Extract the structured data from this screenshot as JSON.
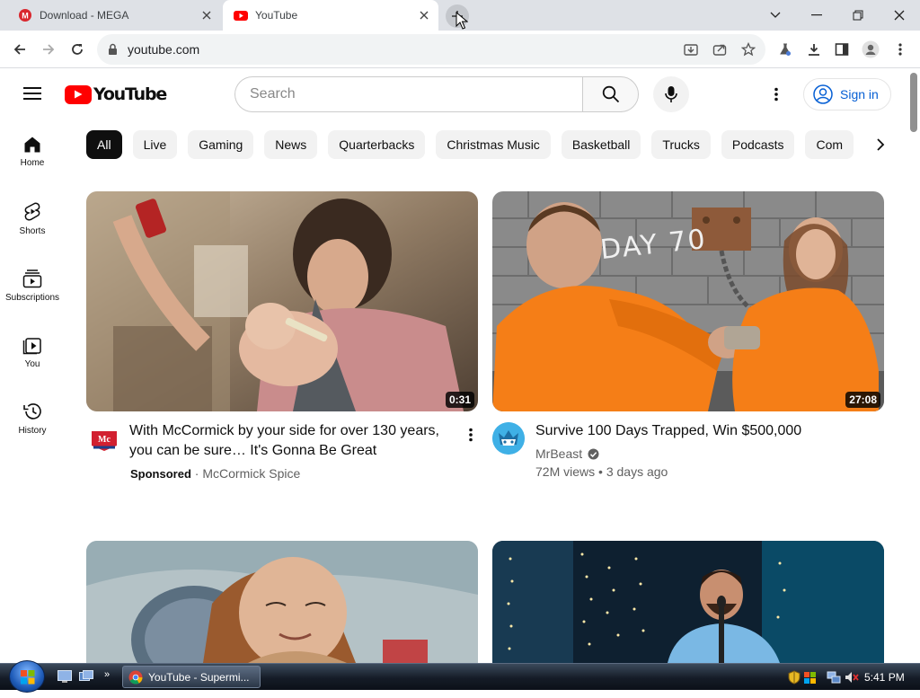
{
  "browser": {
    "tabs": [
      {
        "title": "Download - MEGA",
        "favicon": "mega-icon",
        "active": false
      },
      {
        "title": "YouTube",
        "favicon": "youtube-icon",
        "active": true
      }
    ],
    "url": "youtube.com"
  },
  "masthead": {
    "logo_text": "YouTube",
    "search_placeholder": "Search",
    "sign_in_label": "Sign in"
  },
  "guide": [
    {
      "label": "Home",
      "icon": "home-icon"
    },
    {
      "label": "Shorts",
      "icon": "shorts-icon"
    },
    {
      "label": "Subscriptions",
      "icon": "subscriptions-icon"
    },
    {
      "label": "You",
      "icon": "you-icon"
    },
    {
      "label": "History",
      "icon": "history-icon"
    }
  ],
  "chips": [
    "All",
    "Live",
    "Gaming",
    "News",
    "Quarterbacks",
    "Christmas Music",
    "Basketball",
    "Trucks",
    "Podcasts",
    "Com"
  ],
  "videos": [
    {
      "title": "With McCormick by your side for over 130 years, you can be sure… It's Gonna Be Great",
      "duration": "0:31",
      "sponsored": "Sponsored",
      "separator": "·",
      "channel": "McCormick Spice"
    },
    {
      "title": "Survive 100 Days Trapped, Win $500,000",
      "duration": "27:08",
      "channel": "MrBeast",
      "views": "72M views",
      "separator": "•",
      "age": "3 days ago",
      "thumb_text": "DAY 70"
    }
  ],
  "taskbar": {
    "task_label": "YouTube - Supermi...",
    "clock": "5:41 PM"
  },
  "colors": {
    "youtube_red": "#ff0000",
    "link_blue": "#065fd4",
    "chip_bg": "#f2f2f2",
    "meta_gray": "#606060"
  }
}
